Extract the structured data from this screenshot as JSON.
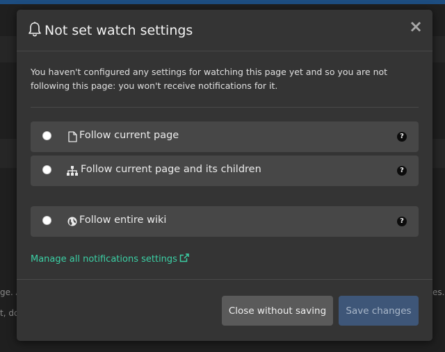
{
  "modal": {
    "title": "Not set watch settings",
    "description": "You haven't configured any settings for watching this page yet and so you are not following this page: you won't receive notifications for it.",
    "options": [
      {
        "label": "Follow current page",
        "icon": "file-icon"
      },
      {
        "label": "Follow current page and its children",
        "icon": "sitemap-icon"
      },
      {
        "label": "Follow entire wiki",
        "icon": "globe-icon"
      }
    ],
    "help_glyph": "?",
    "close_glyph": "×",
    "manage_link": "Manage all notifications settings",
    "buttons": {
      "close_without_saving": "Close without saving",
      "save_changes": "Save changes"
    }
  },
  "background": {
    "fragment_1": "ge. A",
    "fragment_2": "es.",
    "fragment_3": "t, do"
  },
  "colors": {
    "modal_bg": "#343434",
    "option_bg": "#474747",
    "link": "#3bd0a5",
    "save_button": "#3e5678"
  }
}
